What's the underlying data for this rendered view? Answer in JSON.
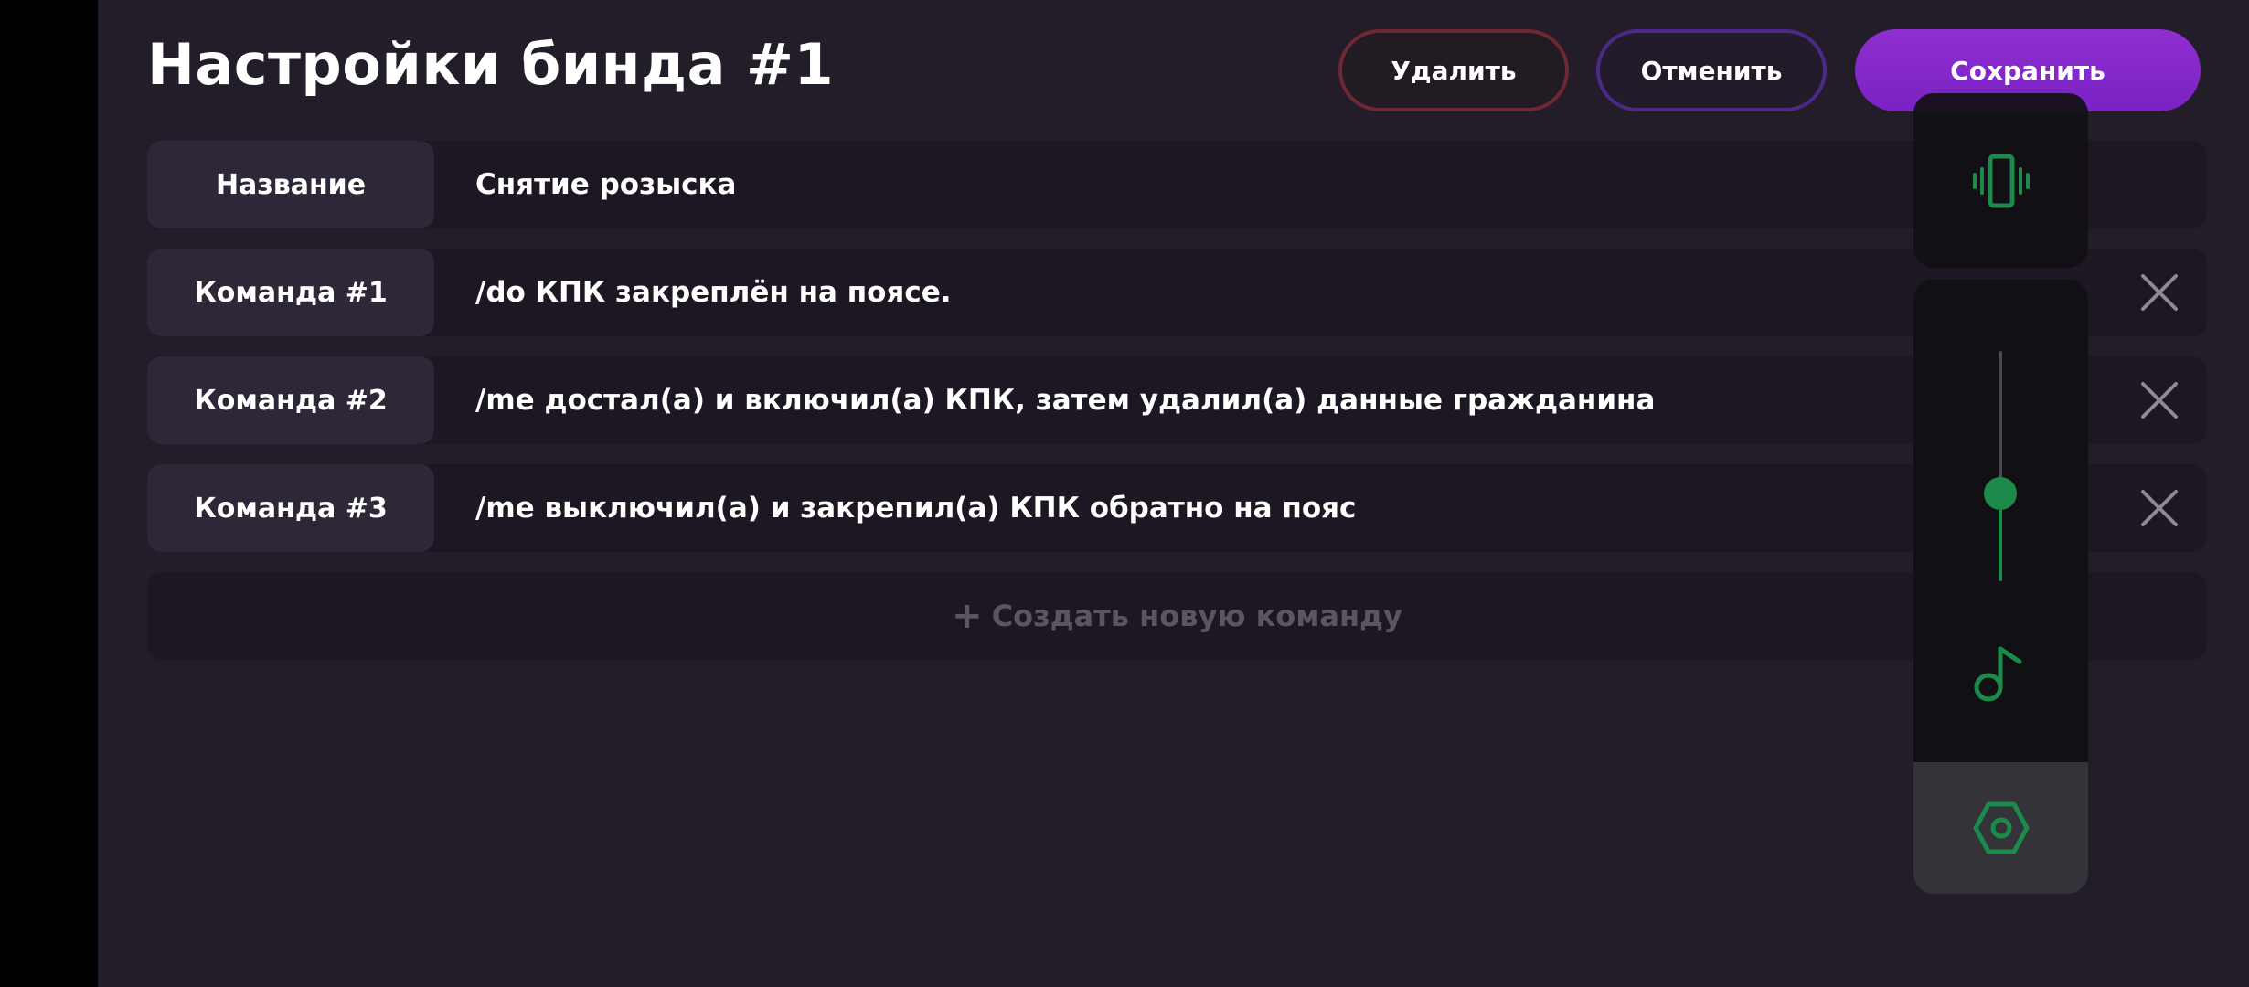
{
  "header": {
    "title": "Настройки бинда #1",
    "delete_label": "Удалить",
    "cancel_label": "Отменить",
    "save_label": "Сохранить"
  },
  "rows": [
    {
      "label": "Название",
      "value": "Снятие розыска",
      "removable": false
    },
    {
      "label": "Команда #1",
      "value": "/do КПК закреплён на поясе.",
      "removable": true
    },
    {
      "label": "Команда #2",
      "value": "/me достал(а) и включил(а) КПК, затем удалил(а) данные гражданина",
      "removable": true
    },
    {
      "label": "Команда #3",
      "value": "/me выключил(а) и закрепил(а) КПК обратно на пояс",
      "removable": true
    }
  ],
  "add_command": {
    "plus": "+",
    "label": "Создать новую команду"
  },
  "volume_panel": {
    "top_icon": "vibrate-icon",
    "level": 0.38,
    "music_icon": "music-note-icon",
    "settings_icon": "hex-settings-icon"
  },
  "colors": {
    "background": "#221d29",
    "row": "#1c1722",
    "label": "#2e2737",
    "delete_border": "#6e2733",
    "cancel_border": "#4b2986",
    "save": "#8a2bce",
    "accent_green": "#1b8a4b"
  },
  "icons": {
    "close": "close-icon"
  }
}
